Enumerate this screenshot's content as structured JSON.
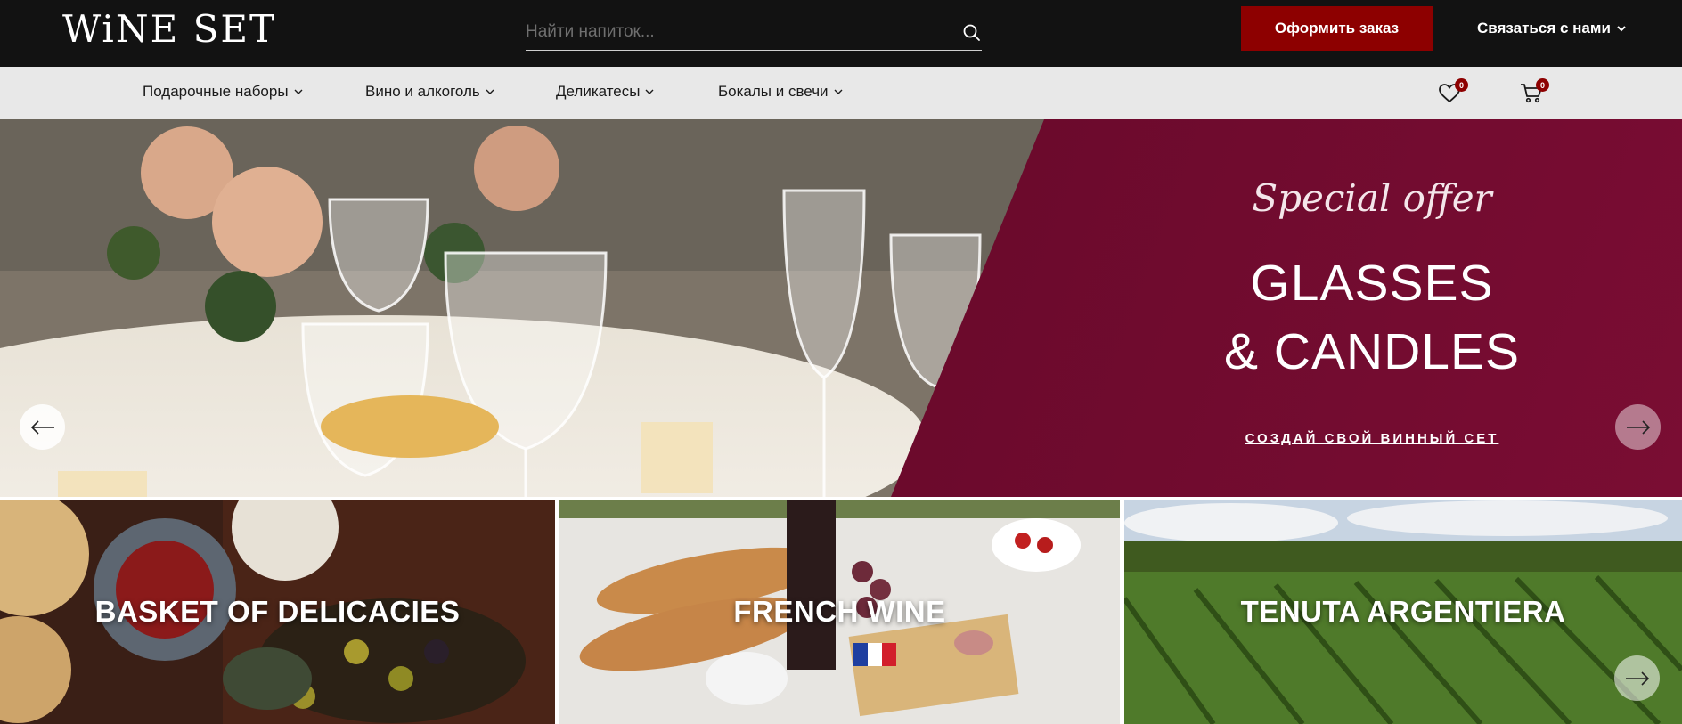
{
  "header": {
    "logo": "WiNE SET",
    "search": {
      "placeholder": "Найти напиток...",
      "value": "",
      "icon": "search-icon"
    },
    "order_button": "Оформить заказ",
    "contact": "Связаться с нами",
    "accent_color": "#8d0000",
    "background_color": "#121212"
  },
  "nav": {
    "items": [
      {
        "label": "Подарочные наборы"
      },
      {
        "label": "Вино и алкоголь"
      },
      {
        "label": "Деликатесы"
      },
      {
        "label": "Бокалы и свечи"
      }
    ],
    "wishlist": {
      "icon": "heart-icon",
      "count": "0"
    },
    "cart": {
      "icon": "cart-icon",
      "count": "0"
    }
  },
  "hero": {
    "kicker": "Special offer",
    "title_line1": "GLASSES",
    "title_line2": "& CANDLES",
    "cta": "СОЗДАЙ СВОЙ ВИННЫЙ СЕТ",
    "panel_color": "#6b0a2c"
  },
  "categories": [
    {
      "title": "BASKET OF DELICACIES"
    },
    {
      "title": "FRENCH WINE"
    },
    {
      "title": "TENUTA ARGENTIERA"
    }
  ]
}
